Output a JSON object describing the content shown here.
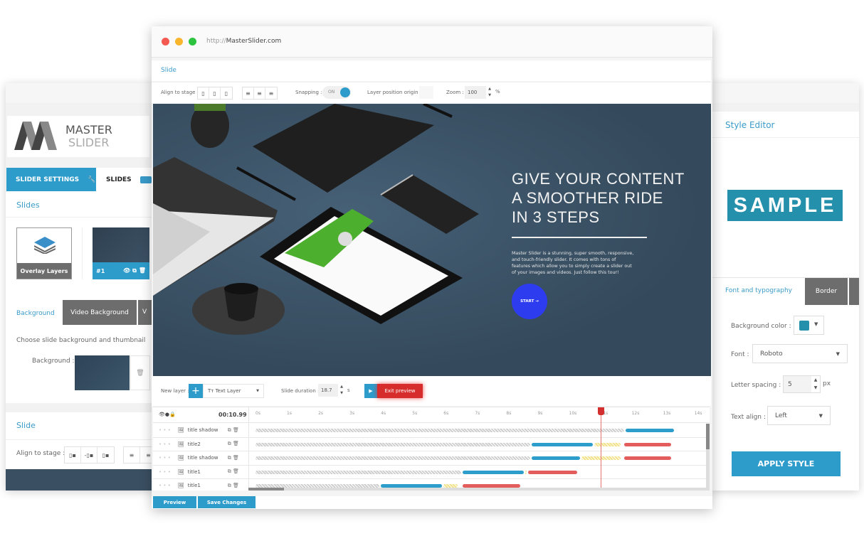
{
  "browser": {
    "url_prefix": "http://",
    "url_host": "MasterSlider.com",
    "dots": [
      "#f45a52",
      "#f9b52c",
      "#2cc43f"
    ]
  },
  "left_panel": {
    "logo_line1": "MASTER",
    "logo_line2": "SLIDER",
    "tabs": [
      {
        "label": "SLIDER SETTINGS",
        "icon": "wrench-icon"
      },
      {
        "label": "SLIDES",
        "icon": "slides-icon"
      }
    ],
    "slides_heading": "Slides",
    "overlay_label": "Overlay Layers",
    "slide_thumb_label": "#1",
    "bg_tabs": [
      "Background",
      "Video Background",
      "V"
    ],
    "bg_hint": "Choose slide background and thumbnail",
    "bg_label": "Background :",
    "slide_heading": "Slide",
    "align_label": "Align to stage :"
  },
  "editor": {
    "section_title": "Slide",
    "align_label": "Align to stage :",
    "snapping_label": "Snapping :",
    "snapping_value": "ON",
    "origin_label": "Layer position origin :",
    "zoom_label": "Zoom :",
    "zoom_value": "100",
    "zoom_unit": "%",
    "slide": {
      "headline": [
        "GIVE YOUR CONTENT",
        "A SMOOTHER RIDE",
        "IN 3 STEPS"
      ],
      "body": "Master Slider is a stunning, super smooth, responsive, and touch-friendly slider. It comes with tons of features which allow you to simply create a slider out of your images and videos. Just follow this tour!",
      "button": "START →",
      "bg_color": "#3a4f62",
      "button_color": "#2e3cf0"
    },
    "new_layer_label": "New layer :",
    "layer_type": "Text Layer",
    "duration_label": "Slide duration :",
    "duration_value": "18.7",
    "duration_unit": "s",
    "exit_preview": "Exit preview",
    "timeline": {
      "current_time": "00:10.99",
      "playhead_s": 11.0,
      "ticks": [
        "0s",
        "1s",
        "2s",
        "3s",
        "4s",
        "5s",
        "6s",
        "7s",
        "8s",
        "9s",
        "10s",
        "11s",
        "12s",
        "13s",
        "14s"
      ],
      "layers": [
        {
          "name": "title shadow",
          "segments": [
            {
              "type": "delay",
              "from": 0,
              "to": 11.8
            },
            {
              "type": "in",
              "from": 11.8,
              "to": 13.4
            }
          ]
        },
        {
          "name": "title2",
          "segments": [
            {
              "type": "delay",
              "from": 0,
              "to": 8.8
            },
            {
              "type": "in",
              "from": 8.8,
              "to": 10.8
            },
            {
              "type": "wait",
              "from": 10.8,
              "to": 11.7
            },
            {
              "type": "out",
              "from": 11.75,
              "to": 13.3
            }
          ]
        },
        {
          "name": "title shadow",
          "segments": [
            {
              "type": "delay",
              "from": 0,
              "to": 8.8
            },
            {
              "type": "in",
              "from": 8.8,
              "to": 10.4
            },
            {
              "type": "wait",
              "from": 10.4,
              "to": 11.7
            },
            {
              "type": "out",
              "from": 11.75,
              "to": 13.3
            }
          ]
        },
        {
          "name": "title1",
          "segments": [
            {
              "type": "delay",
              "from": 0,
              "to": 6.6
            },
            {
              "type": "in",
              "from": 6.6,
              "to": 8.6
            },
            {
              "type": "wait",
              "from": 8.6,
              "to": 8.7
            },
            {
              "type": "out",
              "from": 8.7,
              "to": 10.3
            }
          ]
        },
        {
          "name": "title1",
          "segments": [
            {
              "type": "delay",
              "from": 0,
              "to": 4.0
            },
            {
              "type": "in",
              "from": 4.0,
              "to": 6.0
            },
            {
              "type": "wait",
              "from": 6.0,
              "to": 6.5
            },
            {
              "type": "out",
              "from": 6.6,
              "to": 8.5
            }
          ]
        }
      ],
      "colors": {
        "delay": "#cfcfcf",
        "in": "#2d9dcc",
        "wait": "#f3e28a",
        "out": "#e35d5d"
      }
    },
    "footer": {
      "preview": "Preview",
      "save": "Save Changes"
    }
  },
  "style_editor": {
    "title": "Style Editor",
    "sample": "SAMPLE",
    "sample_bg": "#2590ab",
    "tabs": [
      "Font and typography",
      "Border"
    ],
    "bg_color_label": "Background color :",
    "bg_color_value": "#2590ab",
    "font_label": "Font :",
    "font_value": "Roboto",
    "spacing_label": "Letter spacing :",
    "spacing_value": "5",
    "spacing_unit": "px",
    "align_label": "Text align :",
    "align_value": "Left",
    "apply": "APPLY STYLE"
  }
}
